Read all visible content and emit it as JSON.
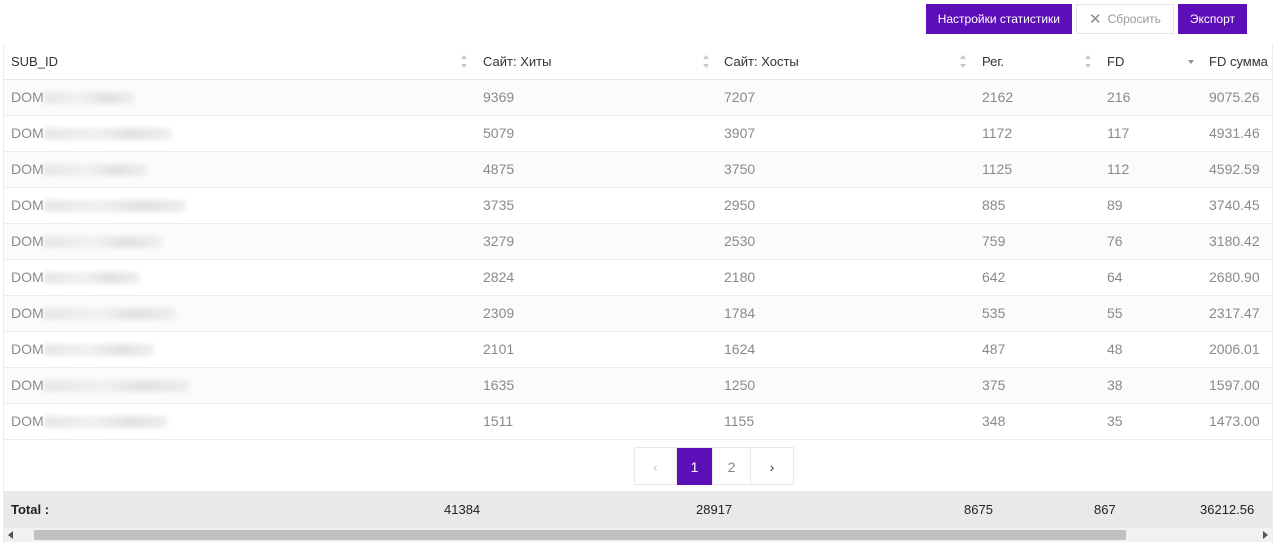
{
  "toolbar": {
    "settings_label": "Настройки статистики",
    "reset_label": "Сбросить",
    "export_label": "Экспорт"
  },
  "table": {
    "columns": [
      "SUB_ID",
      "Сайт: Хиты",
      "Сайт: Хосты",
      "Рег.",
      "FD",
      "FD сумма"
    ],
    "rows": [
      [
        "DOM",
        "9369",
        "7207",
        "2162",
        "216",
        "9075.26"
      ],
      [
        "DOM",
        "5079",
        "3907",
        "1172",
        "117",
        "4931.46"
      ],
      [
        "DOM",
        "4875",
        "3750",
        "1125",
        "112",
        "4592.59"
      ],
      [
        "DOM",
        "3735",
        "2950",
        "885",
        "89",
        "3740.45"
      ],
      [
        "DOM",
        "3279",
        "2530",
        "759",
        "76",
        "3180.42"
      ],
      [
        "DOM",
        "2824",
        "2180",
        "642",
        "64",
        "2680.90"
      ],
      [
        "DOM",
        "2309",
        "1784",
        "535",
        "55",
        "2317.47"
      ],
      [
        "DOM",
        "2101",
        "1624",
        "487",
        "48",
        "2006.01"
      ],
      [
        "DOM",
        "1635",
        "1250",
        "375",
        "38",
        "1597.00"
      ],
      [
        "DOM",
        "1511",
        "1155",
        "348",
        "35",
        "1473.00"
      ]
    ],
    "total": {
      "label": "Total :",
      "values": [
        "41384",
        "28917",
        "8675",
        "867",
        "36212.56"
      ]
    }
  },
  "pagination": {
    "pages": [
      "1",
      "2"
    ],
    "current": "1",
    "prev_glyph": "‹",
    "next_glyph": "›"
  },
  "colors": {
    "accent": "#5c0fb8"
  }
}
